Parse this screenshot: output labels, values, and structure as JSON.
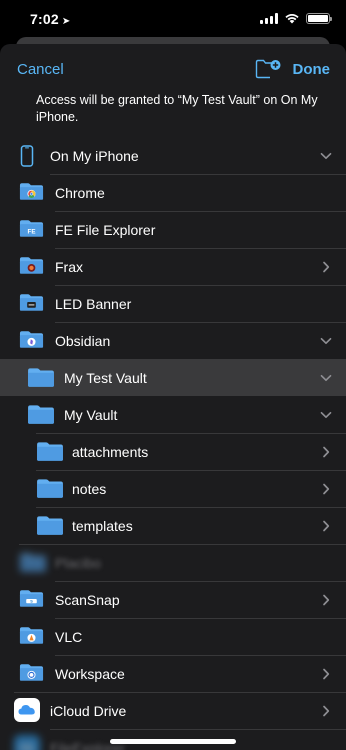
{
  "status_bar": {
    "time": "7:02",
    "location_glyph": "➤"
  },
  "nav": {
    "cancel": "Cancel",
    "done": "Done"
  },
  "message": "Access will be granted to “My Test Vault” on On My iPhone.",
  "colors": {
    "accent": "#59b6f5",
    "folder": "#62aef0",
    "selected_row": "#3a3a3c",
    "sheet": "#1c1c1e"
  },
  "locations": [
    {
      "label": "On My iPhone",
      "icon": "iphone-icon",
      "chevron": "down"
    },
    {
      "label": "Chrome",
      "icon": "chrome-folder-icon",
      "chevron": ""
    },
    {
      "label": "FE File Explorer",
      "icon": "fe-folder-icon",
      "chevron": ""
    },
    {
      "label": "Frax",
      "icon": "frax-folder-icon",
      "chevron": "right"
    },
    {
      "label": "LED Banner",
      "icon": "led-banner-folder-icon",
      "chevron": ""
    },
    {
      "label": "Obsidian",
      "icon": "obsidian-folder-icon",
      "chevron": "down"
    },
    {
      "label": "My Test Vault",
      "icon": "folder-icon",
      "chevron": "down",
      "selected": true
    },
    {
      "label": "My Vault",
      "icon": "folder-icon",
      "chevron": "down"
    },
    {
      "label": "attachments",
      "icon": "folder-icon",
      "chevron": "right"
    },
    {
      "label": "notes",
      "icon": "folder-icon",
      "chevron": "right"
    },
    {
      "label": "templates",
      "icon": "folder-icon",
      "chevron": "right"
    },
    {
      "label": "Placibo",
      "icon": "folder-icon",
      "chevron": ""
    },
    {
      "label": "ScanSnap",
      "icon": "scansnap-folder-icon",
      "chevron": "right"
    },
    {
      "label": "VLC",
      "icon": "vlc-folder-icon",
      "chevron": ""
    },
    {
      "label": "Workspace",
      "icon": "workspace-folder-icon",
      "chevron": "right"
    },
    {
      "label": "iCloud Drive",
      "icon": "icloud-drive-icon",
      "chevron": "right"
    },
    {
      "label": "FileExplorer",
      "icon": "fileexplorer-app-icon",
      "chevron": ""
    }
  ]
}
